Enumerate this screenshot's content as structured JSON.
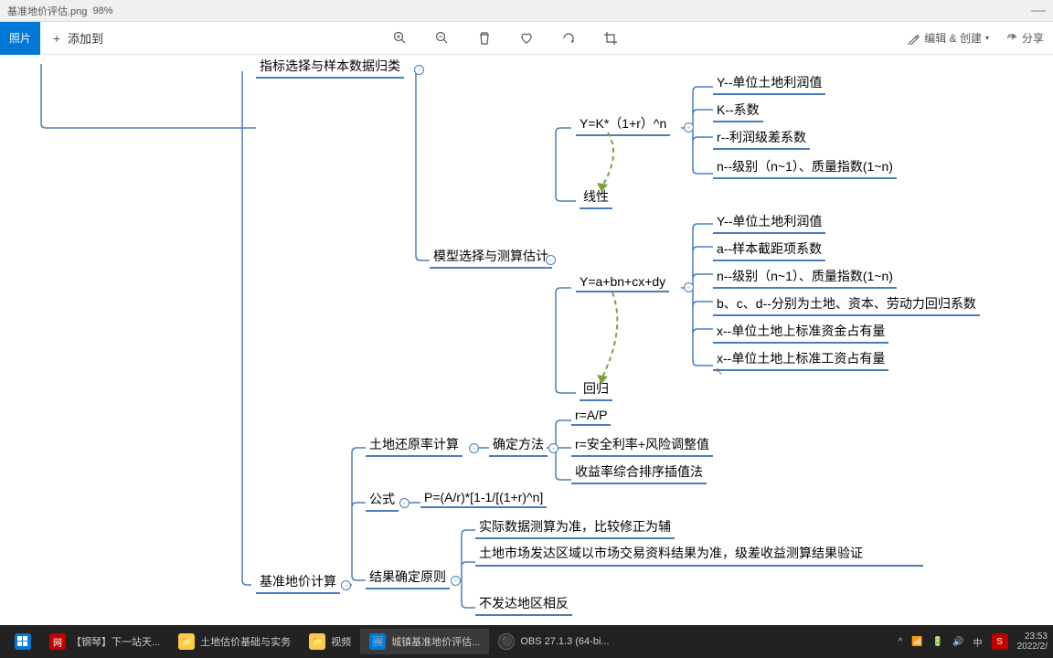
{
  "titlebar": {
    "filename": "基准地价评估.png",
    "zoom": "98%"
  },
  "toolbar": {
    "photo": "照片",
    "addto": "添加到",
    "edit": "编辑 & 创建",
    "share": "分享"
  },
  "mindmap": {
    "n1": "指标选择与样本数据归类",
    "n2": "模型选择与测算估计",
    "n3": "Y=K*（1+r）^n",
    "n3a": "Y--单位土地利润值",
    "n3b": "K--系数",
    "n3c": "r--利润级差系数",
    "n3d": "n--级别（n~1）、质量指数(1~n)",
    "n4": "线性",
    "n5": "Y=a+bn+cx+dy",
    "n5a": "Y--单位土地利润值",
    "n5b": "a--样本截距项系数",
    "n5c": "n--级别（n~1）、质量指数(1~n)",
    "n5d": "b、c、d--分别为土地、资本、劳动力回归系数",
    "n5e": "x--单位土地上标准资金占有量",
    "n5f": "x--单位土地上标准工资占有量",
    "n6": "回归",
    "n7": "土地还原率计算",
    "n8": "确定方法",
    "n8a": "r=A/P",
    "n8b": "r=安全利率+风险调整值",
    "n8c": "收益率综合排序插值法",
    "n9": "公式",
    "n9a": "P=(A/r)*[1-1/[(1+r)^n]",
    "n10": "基准地价计算",
    "n11": "结果确定原则",
    "n11a": "实际数据测算为准，比较修正为辅",
    "n11b": "土地市场发达区域以市场交易资料结果为准，级差收益测算结果验证",
    "n11c": "不发达地区相反"
  },
  "taskbar": {
    "t1": "【钢琴】下一站天...",
    "t2": "土地估价基础与实务",
    "t3": "视频",
    "t4": "城镇基准地价评估...",
    "t5": "OBS 27.1.3 (64-bi...",
    "time": "23:53",
    "date": "2022/2/",
    "ime": "中"
  }
}
